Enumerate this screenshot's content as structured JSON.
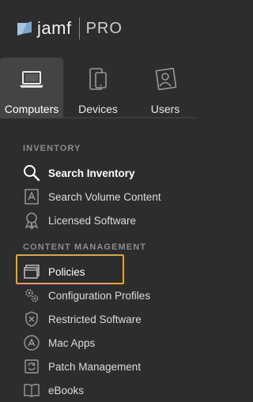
{
  "brand": {
    "logo_name": "jamf",
    "product": "PRO"
  },
  "tabs": [
    {
      "label": "Computers",
      "icon": "laptop-icon",
      "active": true
    },
    {
      "label": "Devices",
      "icon": "mobile-device-icon",
      "active": false
    },
    {
      "label": "Users",
      "icon": "user-portrait-icon",
      "active": false
    }
  ],
  "inventory": {
    "header": "INVENTORY",
    "items": [
      {
        "label": "Search Inventory",
        "icon": "search-icon",
        "selected": true
      },
      {
        "label": "Search Volume Content",
        "icon": "volume-content-icon"
      },
      {
        "label": "Licensed Software",
        "icon": "license-ribbon-icon"
      }
    ]
  },
  "content_management": {
    "header": "CONTENT MANAGEMENT",
    "items": [
      {
        "label": "Policies",
        "icon": "policies-window-icon",
        "highlighted": true
      },
      {
        "label": "Configuration Profiles",
        "icon": "gears-icon"
      },
      {
        "label": "Restricted Software",
        "icon": "shield-x-icon"
      },
      {
        "label": "Mac Apps",
        "icon": "app-store-icon"
      },
      {
        "label": "Patch Management",
        "icon": "patch-refresh-icon"
      },
      {
        "label": "eBooks",
        "icon": "book-icon"
      }
    ]
  },
  "colors": {
    "background": "#2d2d2d",
    "active_tab": "#444444",
    "highlight": "#e8a623",
    "section_header": "#8c8c8c"
  }
}
